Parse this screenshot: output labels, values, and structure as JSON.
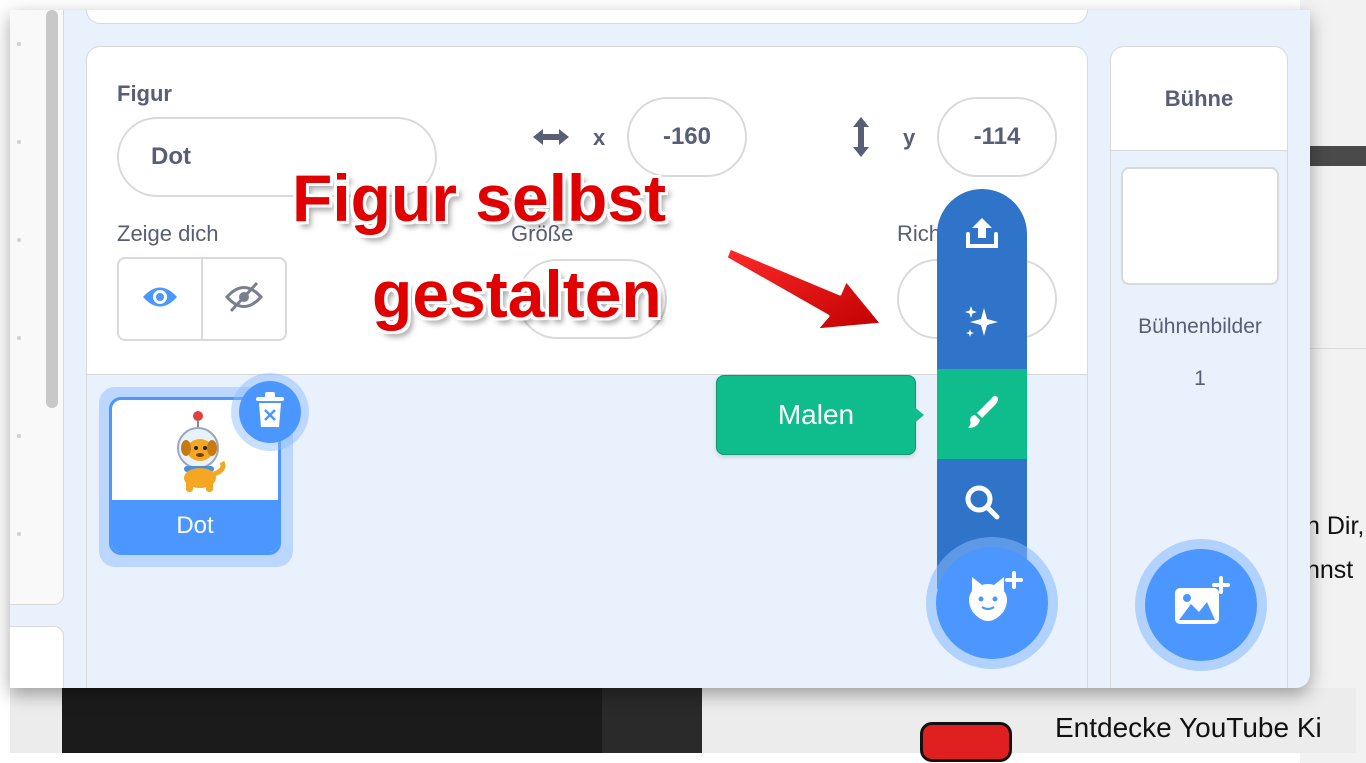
{
  "sprite_info": {
    "title": "Figur",
    "name_value": "Dot",
    "x_label": "x",
    "x_value": "-160",
    "y_label": "y",
    "y_value": "-114",
    "show_label": "Zeige dich",
    "size_label": "Größe",
    "direction_label": "Richt"
  },
  "sprite_tile": {
    "name": "Dot"
  },
  "sprite_menu": {
    "items": [
      {
        "icon": "upload-icon"
      },
      {
        "icon": "surprise-sparkle-icon"
      },
      {
        "icon": "paint-brush-icon"
      },
      {
        "icon": "search-icon"
      }
    ],
    "tooltip": "Malen",
    "main_button_icon": "cat-plus-icon"
  },
  "stage_panel": {
    "title": "Bühne",
    "backdrops_label": "Bühnenbilder",
    "backdrops_count": "1",
    "add_backdrop_icon": "image-plus-icon"
  },
  "annotation": {
    "line1": "Figur selbst",
    "line2": "gestalten",
    "color": "#e00000"
  },
  "background_page": {
    "right_line1": "n Dir,",
    "right_line2": "nnst",
    "bottom_text": "Entdecke YouTube Ki"
  },
  "colors": {
    "scratch_blue": "#4c97ff",
    "menu_blue": "#2f74c8",
    "paint_green": "#0fbd8c",
    "text_gray": "#575e75"
  }
}
